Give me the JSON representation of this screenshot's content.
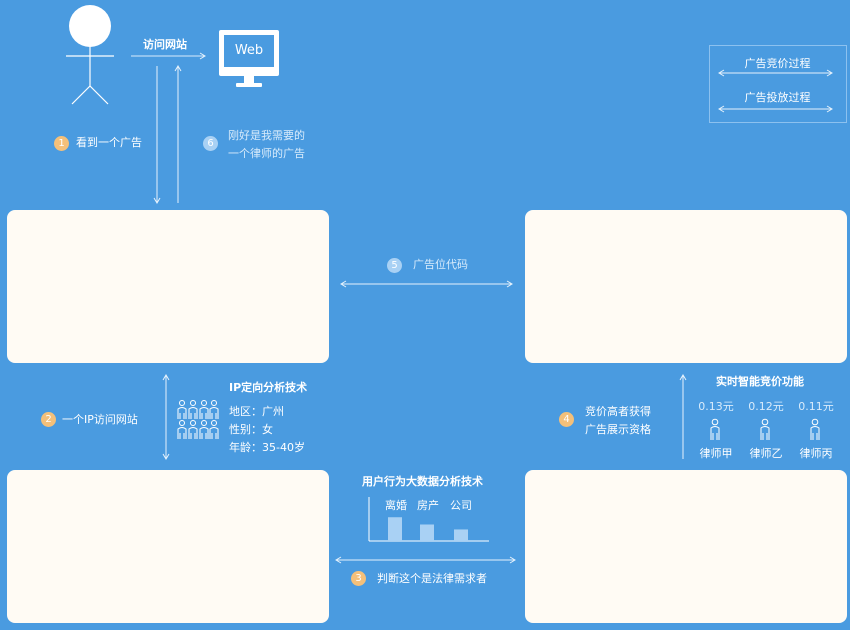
{
  "legend": {
    "bidding": "广告竞价过程",
    "delivery": "广告投放过程"
  },
  "top": {
    "visit_label": "访问网站",
    "web_label": "Web"
  },
  "steps": {
    "s1": {
      "num": "1",
      "text": "看到一个广告"
    },
    "s2": {
      "num": "2",
      "text": "一个IP访问网站"
    },
    "s3": {
      "num": "3",
      "text": "判断这个是法律需求者"
    },
    "s4": {
      "num": "4",
      "line1": "竞价高者获得",
      "line2": "广告展示资格"
    },
    "s5": {
      "num": "5",
      "text": "广告位代码"
    },
    "s6": {
      "num": "6",
      "line1": "刚好是我需要的",
      "line2": "一个律师的广告"
    }
  },
  "ip_targeting": {
    "title": "IP定向分析技术",
    "region": "地区：广州",
    "gender": "性别：女",
    "age": "年龄：35-40岁"
  },
  "bigdata": {
    "title": "用户行为大数据分析技术",
    "bars": [
      {
        "label": "离婚",
        "value": 0.72
      },
      {
        "label": "房产",
        "value": 0.5
      },
      {
        "label": "公司",
        "value": 0.35
      }
    ]
  },
  "bidding": {
    "title": "实时智能竞价功能",
    "lawyers": [
      {
        "price": "0.13元",
        "name": "律师甲"
      },
      {
        "price": "0.12元",
        "name": "律师乙"
      },
      {
        "price": "0.11元",
        "name": "律师丙"
      }
    ]
  },
  "colors": {
    "background": "#4a9be0",
    "card": "#fffbf4",
    "badge_orange": "#f4c07a",
    "badge_light": "#a9d1f4",
    "bar": "#a9d1f4"
  }
}
